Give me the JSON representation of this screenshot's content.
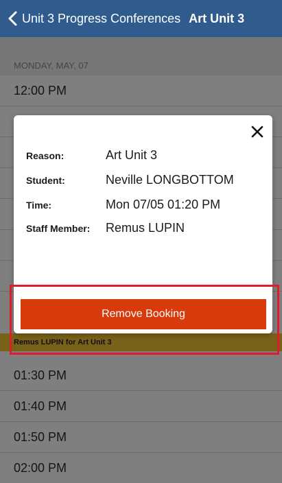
{
  "navbar": {
    "back_label": "Unit 3 Progress Conferences",
    "title": "Art Unit 3"
  },
  "schedule": {
    "section_header": "MONDAY, MAY, 07",
    "rows": [
      "12:00 PM",
      "01:30 PM",
      "01:40 PM",
      "01:50 PM",
      "02:00 PM"
    ],
    "booked_label": "Remus LUPIN for Art Unit 3"
  },
  "modal": {
    "reason_label": "Reason:",
    "reason_value": "Art Unit 3",
    "student_label": "Student:",
    "student_value": "Neville LONGBOTTOM",
    "time_label": "Time:",
    "time_value": "Mon 07/05 01:20 PM",
    "staff_label": "Staff Member:",
    "staff_value": "Remus LUPIN",
    "remove_label": "Remove Booking"
  },
  "colors": {
    "navbar": "#2f5c8c",
    "button": "#d93a0c",
    "highlight": "#e11b2a",
    "booked": "#f1c232"
  }
}
